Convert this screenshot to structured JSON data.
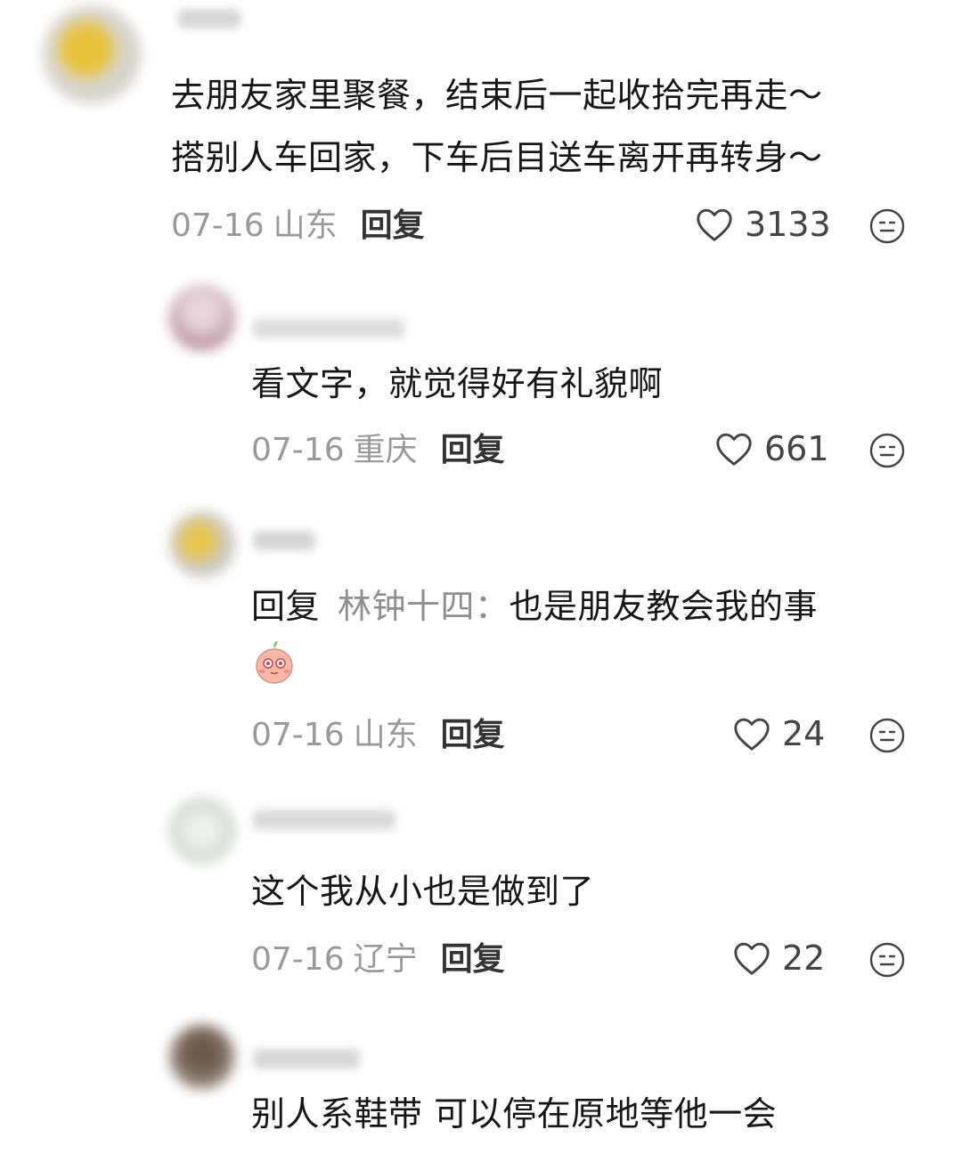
{
  "comments": [
    {
      "lines": [
        "去朋友家里聚餐，结束后一起收拾完再走～",
        "搭别人车回家，下车后目送车离开再转身～"
      ],
      "date": "07-16",
      "region": "山东",
      "reply_label": "回复",
      "likes": "3133"
    },
    {
      "lines": [
        "看文字，就觉得好有礼貌啊"
      ],
      "date": "07-16",
      "region": "重庆",
      "reply_label": "回复",
      "likes": "661"
    },
    {
      "reply_prefix": "回复",
      "reply_target": "林钟十四：",
      "line": "也是朋友教会我的事",
      "date": "07-16",
      "region": "山东",
      "reply_label": "回复",
      "likes": "24"
    },
    {
      "lines": [
        "这个我从小也是做到了"
      ],
      "date": "07-16",
      "region": "辽宁",
      "reply_label": "回复",
      "likes": "22"
    },
    {
      "lines": [
        "别人系鞋带 可以停在原地等他一会"
      ]
    }
  ],
  "icons": {
    "like": "heart-outline-icon",
    "dislike": "meh-face-icon",
    "emoji": "peach-blush-emoji"
  },
  "colors": {
    "text": "#161616",
    "meta_gray": "#9a9a9a",
    "reply_target": "#8f8f8f"
  }
}
